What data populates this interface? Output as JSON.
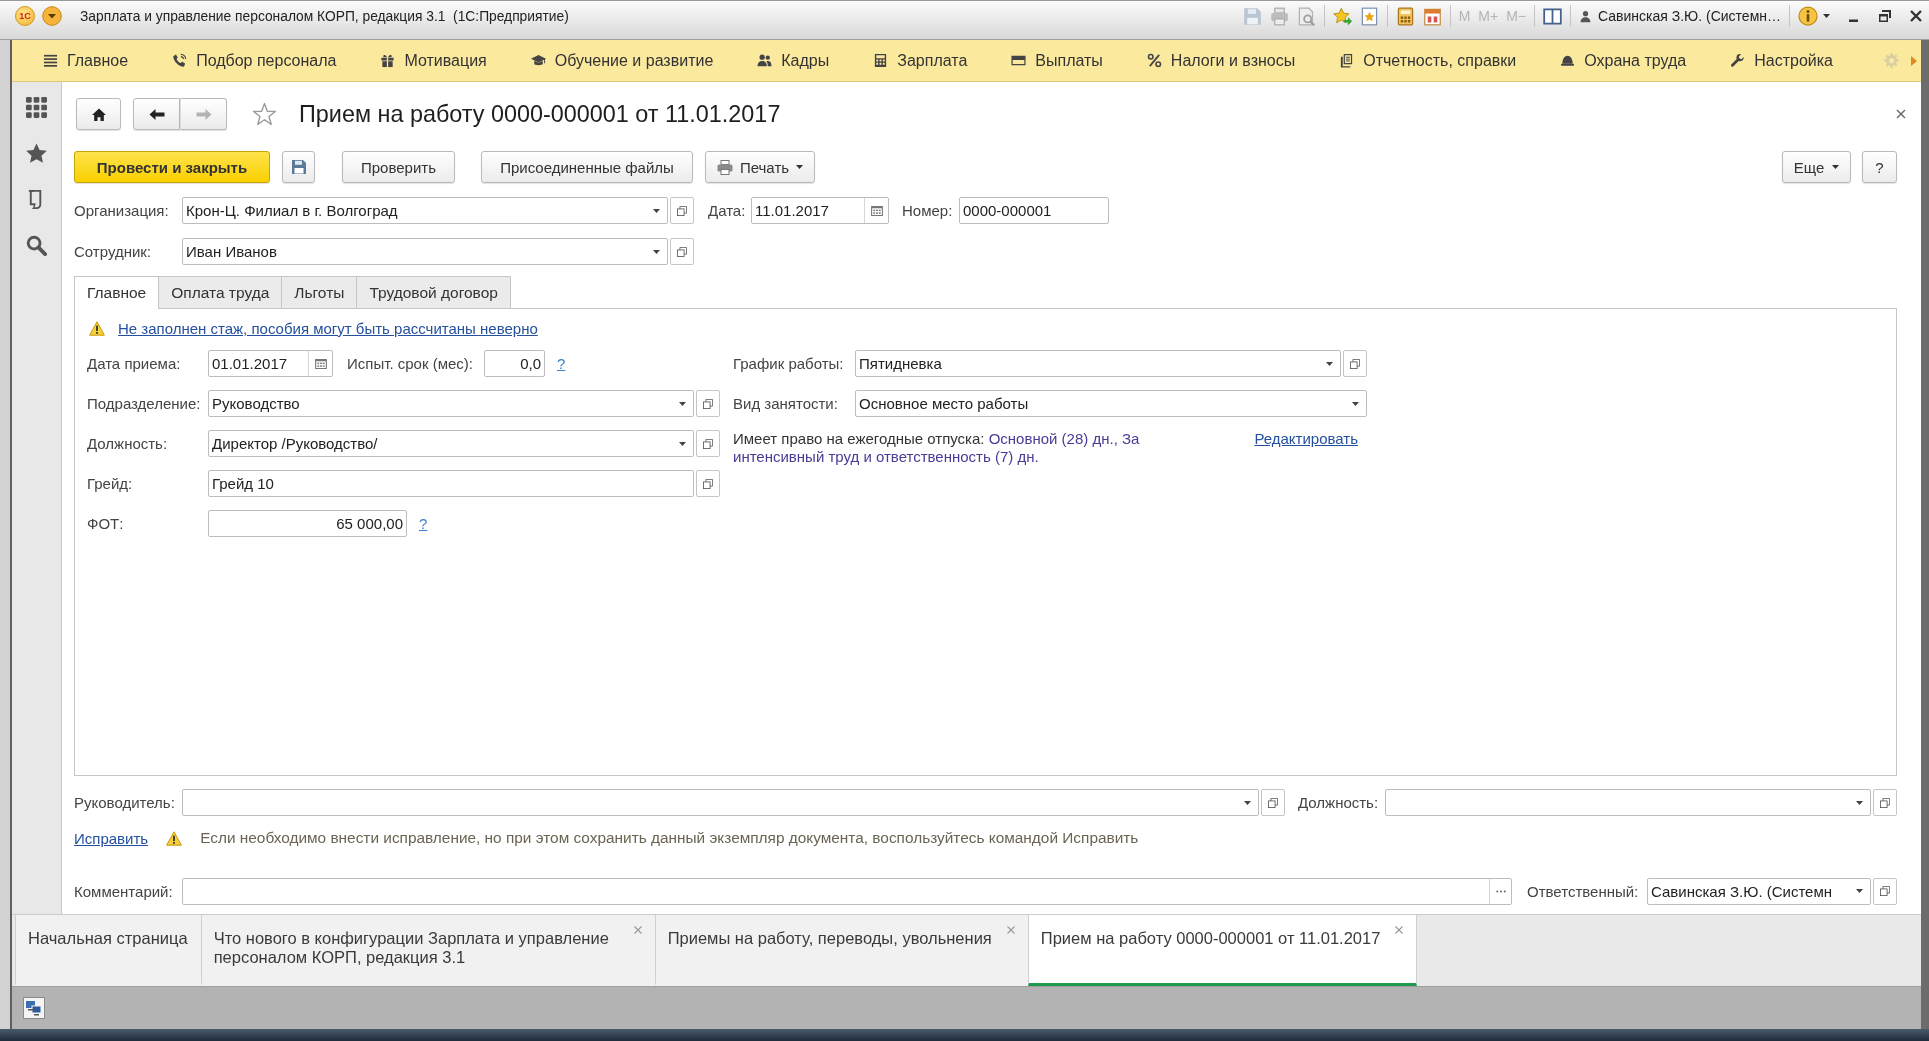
{
  "window": {
    "logo": "1С",
    "title": "Зарплата и управление персоналом КОРП, редакция 3.1  (1С:Предприятие)",
    "memory_buttons": [
      {
        "label": "M",
        "disabled": true
      },
      {
        "label": "M+",
        "disabled": true
      },
      {
        "label": "M−",
        "disabled": true
      }
    ],
    "user": "Савинская З.Ю. (Системн…"
  },
  "sections": [
    {
      "label": "Главное",
      "selected": false
    },
    {
      "label": "Подбор персонала",
      "selected": false
    },
    {
      "label": "Мотивация",
      "selected": false
    },
    {
      "label": "Обучение и развитие",
      "selected": false
    },
    {
      "label": "Кадры",
      "selected": false
    },
    {
      "label": "Зарплата",
      "selected": false
    },
    {
      "label": "Выплаты",
      "selected": false
    },
    {
      "label": "Налоги и взносы",
      "selected": false
    },
    {
      "label": "Отчетность, справки",
      "selected": false
    },
    {
      "label": "Охрана труда",
      "selected": false
    },
    {
      "label": "Настройка",
      "selected": false
    }
  ],
  "document": {
    "title": "Прием на работу 0000-000001 от 11.01.2017",
    "favorite": false,
    "nav": {
      "back": {
        "disabled": false
      },
      "forward": {
        "disabled": true
      }
    },
    "commands": {
      "post": "Провести и закрыть",
      "check": "Проверить",
      "files": "Присоединенные файлы",
      "print": "Печать",
      "more": "Еще",
      "help": "?"
    },
    "header": {
      "organization": {
        "label": "Организация:",
        "value": "Крон-Ц. Филиал в г. Волгоград"
      },
      "date": {
        "label": "Дата:",
        "value": "11.01.2017"
      },
      "number": {
        "label": "Номер:",
        "value": "0000-000001"
      },
      "employee": {
        "label": "Сотрудник:",
        "value": "Иван Иванов"
      }
    },
    "tabs": [
      {
        "label": "Главное",
        "selected": true
      },
      {
        "label": "Оплата труда",
        "selected": false
      },
      {
        "label": "Льготы",
        "selected": false
      },
      {
        "label": "Трудовой договор",
        "selected": false
      }
    ],
    "main_tab": {
      "warning": "Не заполнен стаж, пособия могут быть рассчитаны неверно",
      "hire_date": {
        "label": "Дата приема:",
        "value": "01.01.2017"
      },
      "probation": {
        "label": "Испыт. срок (мес):",
        "value": "0,0",
        "help": "?"
      },
      "department": {
        "label": "Подразделение:",
        "value": "Руководство"
      },
      "position": {
        "label": "Должность:",
        "value": "Директор /Руководство/"
      },
      "grade": {
        "label": "Грейд:",
        "value": "Грейд 10"
      },
      "payroll": {
        "label": "ФОТ:",
        "value": "65 000,00",
        "help": "?"
      },
      "schedule": {
        "label": "График работы:",
        "value": "Пятидневка"
      },
      "employment_type": {
        "label": "Вид занятости:",
        "value": "Основное место работы"
      },
      "vacation": {
        "label": "Имеет право на ежегодные отпуска:",
        "value": "Основной (28) дн., За интенсивный труд и ответственность (7) дн.",
        "edit_link": "Редактировать"
      }
    },
    "footer": {
      "manager": {
        "label": "Руководитель:"
      },
      "manager_position": {
        "label": "Должность:"
      },
      "fix_link": "Исправить",
      "fix_note": "Если необходимо внести исправление, но при этом сохранить данный экземпляр документа, воспользуйтесь командой Исправить",
      "comment": {
        "label": "Комментарий:"
      },
      "responsible": {
        "label": "Ответственный:",
        "value": "Савинская З.Ю. (Системн"
      }
    }
  },
  "open_tabs": [
    {
      "label": "Начальная страница",
      "closable": false,
      "selected": false
    },
    {
      "label": "Что нового в конфигурации Зарплата и управление персоналом КОРП, редакция 3.1",
      "closable": true,
      "selected": false
    },
    {
      "label": "Приемы на работу, переводы, увольнения",
      "closable": true,
      "selected": false
    },
    {
      "label": "Прием на работу 0000-000001 от 11.01.2017",
      "closable": true,
      "selected": true
    }
  ]
}
